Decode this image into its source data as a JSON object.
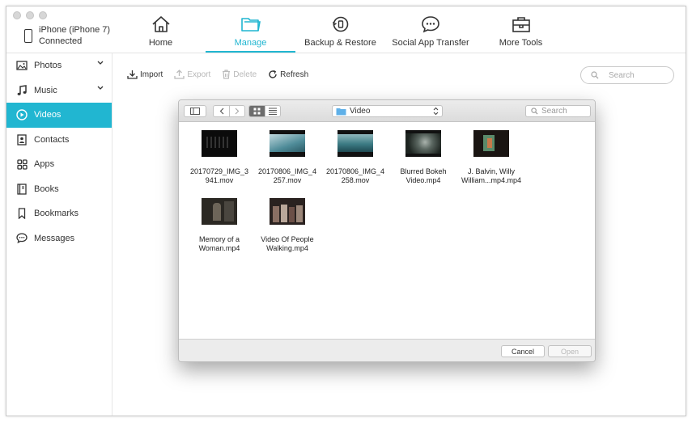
{
  "device": {
    "name": "iPhone (iPhone 7)",
    "status": "Connected"
  },
  "topnav": {
    "items": [
      {
        "label": "Home",
        "icon": "home-icon"
      },
      {
        "label": "Manage",
        "icon": "folder-icon",
        "active": true
      },
      {
        "label": "Backup & Restore",
        "icon": "backup-icon"
      },
      {
        "label": "Social App Transfer",
        "icon": "chat-icon"
      },
      {
        "label": "More Tools",
        "icon": "toolbox-icon"
      }
    ],
    "accent": "#21b6d1"
  },
  "sidebar": {
    "items": [
      {
        "label": "Photos",
        "icon": "photo-icon"
      },
      {
        "label": "Music",
        "icon": "music-icon"
      },
      {
        "label": "Videos",
        "icon": "play-icon",
        "active": true
      },
      {
        "label": "Contacts",
        "icon": "contacts-icon"
      },
      {
        "label": "Apps",
        "icon": "apps-icon"
      },
      {
        "label": "Books",
        "icon": "book-icon"
      },
      {
        "label": "Bookmarks",
        "icon": "bookmark-icon"
      },
      {
        "label": "Messages",
        "icon": "message-icon"
      }
    ]
  },
  "toolbar": {
    "import": "Import",
    "export": "Export",
    "delete": "Delete",
    "refresh": "Refresh"
  },
  "search": {
    "placeholder": "Search"
  },
  "dialog": {
    "folder": "Video",
    "search_placeholder": "Search",
    "files": [
      {
        "line1": "20170729_IMG_3",
        "line2": "941.mov"
      },
      {
        "line1": "20170806_IMG_4",
        "line2": "257.mov"
      },
      {
        "line1": "20170806_IMG_4",
        "line2": "258.mov"
      },
      {
        "line1": "Blurred Bokeh",
        "line2": "Video.mp4"
      },
      {
        "line1": "J. Balvin, Willy",
        "line2": "William...mp4.mp4"
      },
      {
        "line1": "Memory of a",
        "line2": "Woman.mp4"
      },
      {
        "line1": "Video Of People",
        "line2": "Walking.mp4"
      }
    ],
    "cancel": "Cancel",
    "open": "Open"
  }
}
